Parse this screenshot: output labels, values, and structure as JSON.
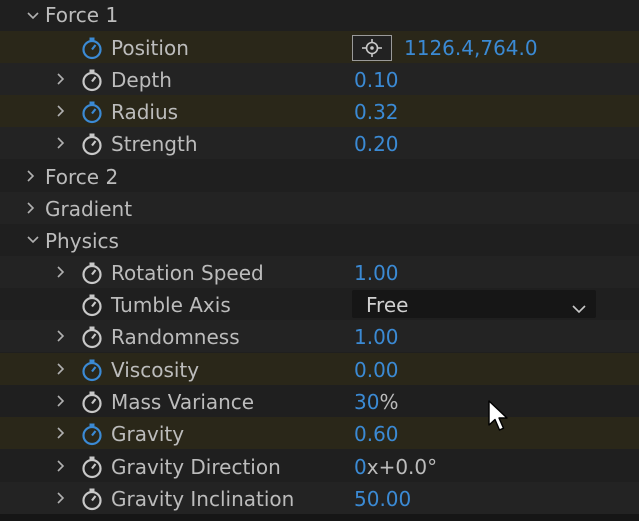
{
  "groups": {
    "force1": "Force 1",
    "force2": "Force 2",
    "gradient": "Gradient",
    "physics": "Physics"
  },
  "force1": {
    "position": {
      "label": "Position",
      "value": "1126.4,764.0"
    },
    "depth": {
      "label": "Depth",
      "value": "0.10"
    },
    "radius": {
      "label": "Radius",
      "value": "0.32"
    },
    "strength": {
      "label": "Strength",
      "value": "0.20"
    }
  },
  "physics": {
    "rotation_speed": {
      "label": "Rotation Speed",
      "value": "1.00"
    },
    "tumble_axis": {
      "label": "Tumble Axis",
      "value": "Free"
    },
    "randomness": {
      "label": "Randomness",
      "value": "1.00"
    },
    "viscosity": {
      "label": "Viscosity",
      "value": "0.00"
    },
    "mass_variance": {
      "label": "Mass Variance",
      "value": "30",
      "unit": "%"
    },
    "gravity": {
      "label": "Gravity",
      "value": "0.60"
    },
    "gravity_direction": {
      "label": "Gravity Direction",
      "revolutions": "0",
      "x": "x",
      "degrees": "+0.0",
      "deg_sym": "°"
    },
    "gravity_inclination": {
      "label": "Gravity Inclination",
      "value": "50.00"
    }
  },
  "colors": {
    "value_blue": "#3b8ad4",
    "label_gray": "#bcbcbc",
    "background": "#1f1f1f",
    "keyed_stopwatch": "#3b8ad4",
    "stopwatch": "#c8c8c8"
  },
  "icons": {
    "twirl_open": "chevron-down-icon",
    "twirl_closed": "chevron-right-icon",
    "stopwatch": "stopwatch-icon",
    "target": "crosshair-icon",
    "dropdown": "chevron-down-icon",
    "cursor": "mouse-pointer-icon"
  }
}
